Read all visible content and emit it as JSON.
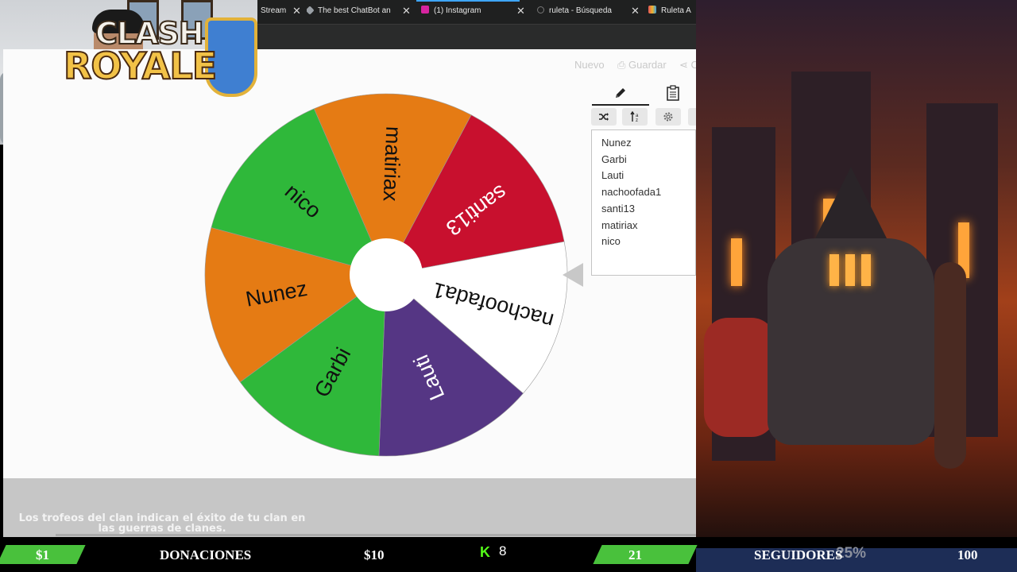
{
  "tabs": [
    {
      "label": "Stream",
      "icon": "stream-tab-icon",
      "color": "#3d3d3d"
    },
    {
      "label": "The best ChatBot an",
      "icon": "chatbot-tab-icon",
      "color": "#9aa0a6"
    },
    {
      "label": "(1) Instagram",
      "icon": "instagram-tab-icon",
      "color": "#d6249f"
    },
    {
      "label": "ruleta - Búsqueda",
      "icon": "search-tab-icon",
      "color": "#5f6368"
    },
    {
      "label": "Ruleta A",
      "icon": "ruleta-tab-icon",
      "color": "#e2525a"
    }
  ],
  "toolbar": {
    "nuevo": "Nuevo",
    "guardar": "Guardar",
    "share": "C"
  },
  "wheel": {
    "segments": [
      {
        "label": "santi13",
        "color": "#c8102e",
        "text_color": "#ffffff"
      },
      {
        "label": "nachoofada1",
        "color": "#ffffff",
        "text_color": "#111111"
      },
      {
        "label": "Lauti",
        "color": "#553684",
        "text_color": "#ffffff"
      },
      {
        "label": "Garbi",
        "color": "#2fb83a",
        "text_color": "#111111"
      },
      {
        "label": "Nunez",
        "color": "#e57b14",
        "text_color": "#111111"
      },
      {
        "label": "nico",
        "color": "#2fb83a",
        "text_color": "#111111"
      },
      {
        "label": "matiriax",
        "color": "#e57b14",
        "text_color": "#111111"
      }
    ]
  },
  "editor": {
    "tab_edit_icon": "pencil-icon",
    "tab_list_icon": "clipboard-icon",
    "buttons": [
      {
        "icon": "shuffle-icon"
      },
      {
        "icon": "sort-icon"
      },
      {
        "icon": "settings-icon"
      }
    ],
    "names": [
      "Nunez",
      "Garbi",
      "Lauti",
      "nachoofada1",
      "santi13",
      "matiriax",
      "nico"
    ]
  },
  "game": {
    "logo_line1": "CLASH",
    "logo_line2": "ROYALE",
    "caption": "Los trofeos del clan indican el éxito de tu clan en las guerras de clanes."
  },
  "footer": {
    "donation_min": "$1",
    "donations_label": "DONACIONES",
    "donation_goal": "$10",
    "kick_count": "8",
    "followers_current": "21",
    "followers_label": "SEGUIDORES",
    "followers_percent": "25%",
    "followers_goal": "100"
  },
  "colors": {
    "accent_green": "#49c13c",
    "kick_green": "#53fc18",
    "pointer": "#c8c8c8"
  }
}
